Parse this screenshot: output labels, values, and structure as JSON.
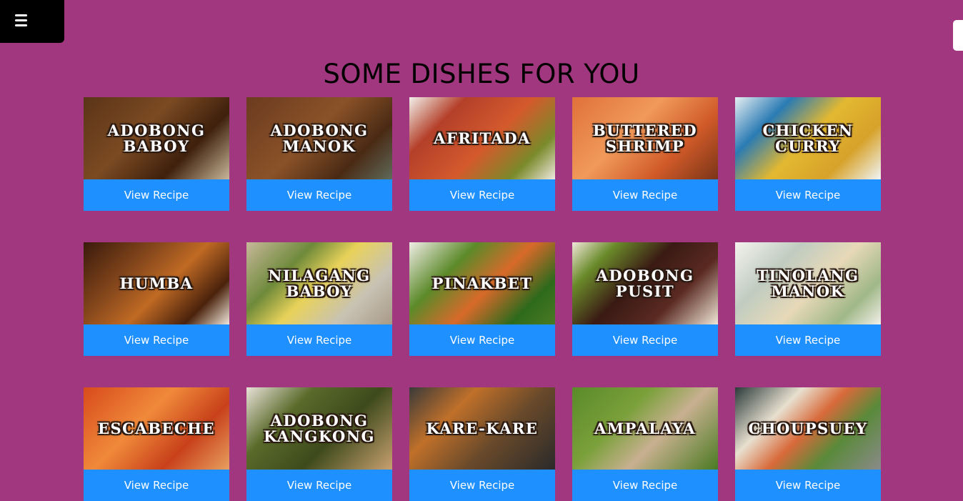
{
  "header": {
    "title": "SOME DISHES FOR YOU",
    "menu_icon": "hamburger-icon"
  },
  "button_label": "View Recipe",
  "colors": {
    "background": "#a1377e",
    "button": "#1e90ff"
  },
  "dishes": [
    {
      "name": "ADOBONG BABOY",
      "bg": "linear-gradient(135deg,#5a3418 0%,#7b4a22 40%,#3e200c 70%,#c9b79a 100%)"
    },
    {
      "name": "ADOBONG MANOK",
      "bg": "linear-gradient(135deg,#6b3b1f 0%,#8a5228 45%,#4a2a14 75%,#5f6a5a 100%)"
    },
    {
      "name": "AFRITADA",
      "bg": "linear-gradient(135deg,#f2f0ea 0%,#b4402a 25%,#d45a2c 55%,#7a8a2a 80%,#efe9e0 100%)"
    },
    {
      "name": "BUTTERED SHRIMP",
      "bg": "linear-gradient(135deg,#e0713a 0%,#f09a5a 40%,#d05a28 70%,#7a3418 100%)"
    },
    {
      "name": "CHICKEN CURRY",
      "bg": "linear-gradient(135deg,#e6eef2 0%,#2a7bb4 25%,#e3b830 50%,#d7a22a 75%,#f0f4f6 100%)"
    },
    {
      "name": "HUMBA",
      "bg": "linear-gradient(135deg,#3a1a0c 0%,#8a4a1c 35%,#c06a24 55%,#4a220c 80%,#f0e6da 100%)"
    },
    {
      "name": "NILAGANG BABOY",
      "bg": "linear-gradient(135deg,#c7b89a 0%,#6e8a3a 30%,#e8d25a 50%,#c8c2b4 75%,#a89a86 100%)"
    },
    {
      "name": "PINAKBET",
      "bg": "linear-gradient(135deg,#f0ede6 0%,#5c8a2a 30%,#d86a2a 55%,#2e6a1c 80%,#4a7a22 100%)"
    },
    {
      "name": "ADOBONG PUSIT",
      "bg": "linear-gradient(135deg,#f0e8d8 0%,#6a8a2a 20%,#3a1a14 45%,#5a2a22 70%,#efe6d6 100%)"
    },
    {
      "name": "TINOLANG MANOK",
      "bg": "linear-gradient(135deg,#f4f2ee 0%,#c0ccc0 30%,#e7d9b8 55%,#a0b888 80%,#f2efe8 100%)"
    },
    {
      "name": "ESCABECHE",
      "bg": "linear-gradient(135deg,#d84a1c 0%,#f08a3a 40%,#c8401a 70%,#e8a060 100%)"
    },
    {
      "name": "ADOBONG KANGKONG",
      "bg": "linear-gradient(135deg,#e8e2d8 0%,#5a6a2a 30%,#3e4a1c 60%,#c8a070 100%)"
    },
    {
      "name": "KARE-KARE",
      "bg": "linear-gradient(135deg,#3a3a3a 0%,#c0702a 30%,#6a4a2a 60%,#2a2a2a 100%)"
    },
    {
      "name": "AMPALAYA",
      "bg": "linear-gradient(135deg,#5a8a2a 0%,#7aa03a 35%,#c8b090 60%,#4a7a22 100%)"
    },
    {
      "name": "CHOUPSUEY",
      "bg": "linear-gradient(135deg,#2a3a3a 0%,#e8e0d0 30%,#d86a3a 50%,#5a8a3a 70%,#8a8a8a 100%)"
    }
  ]
}
